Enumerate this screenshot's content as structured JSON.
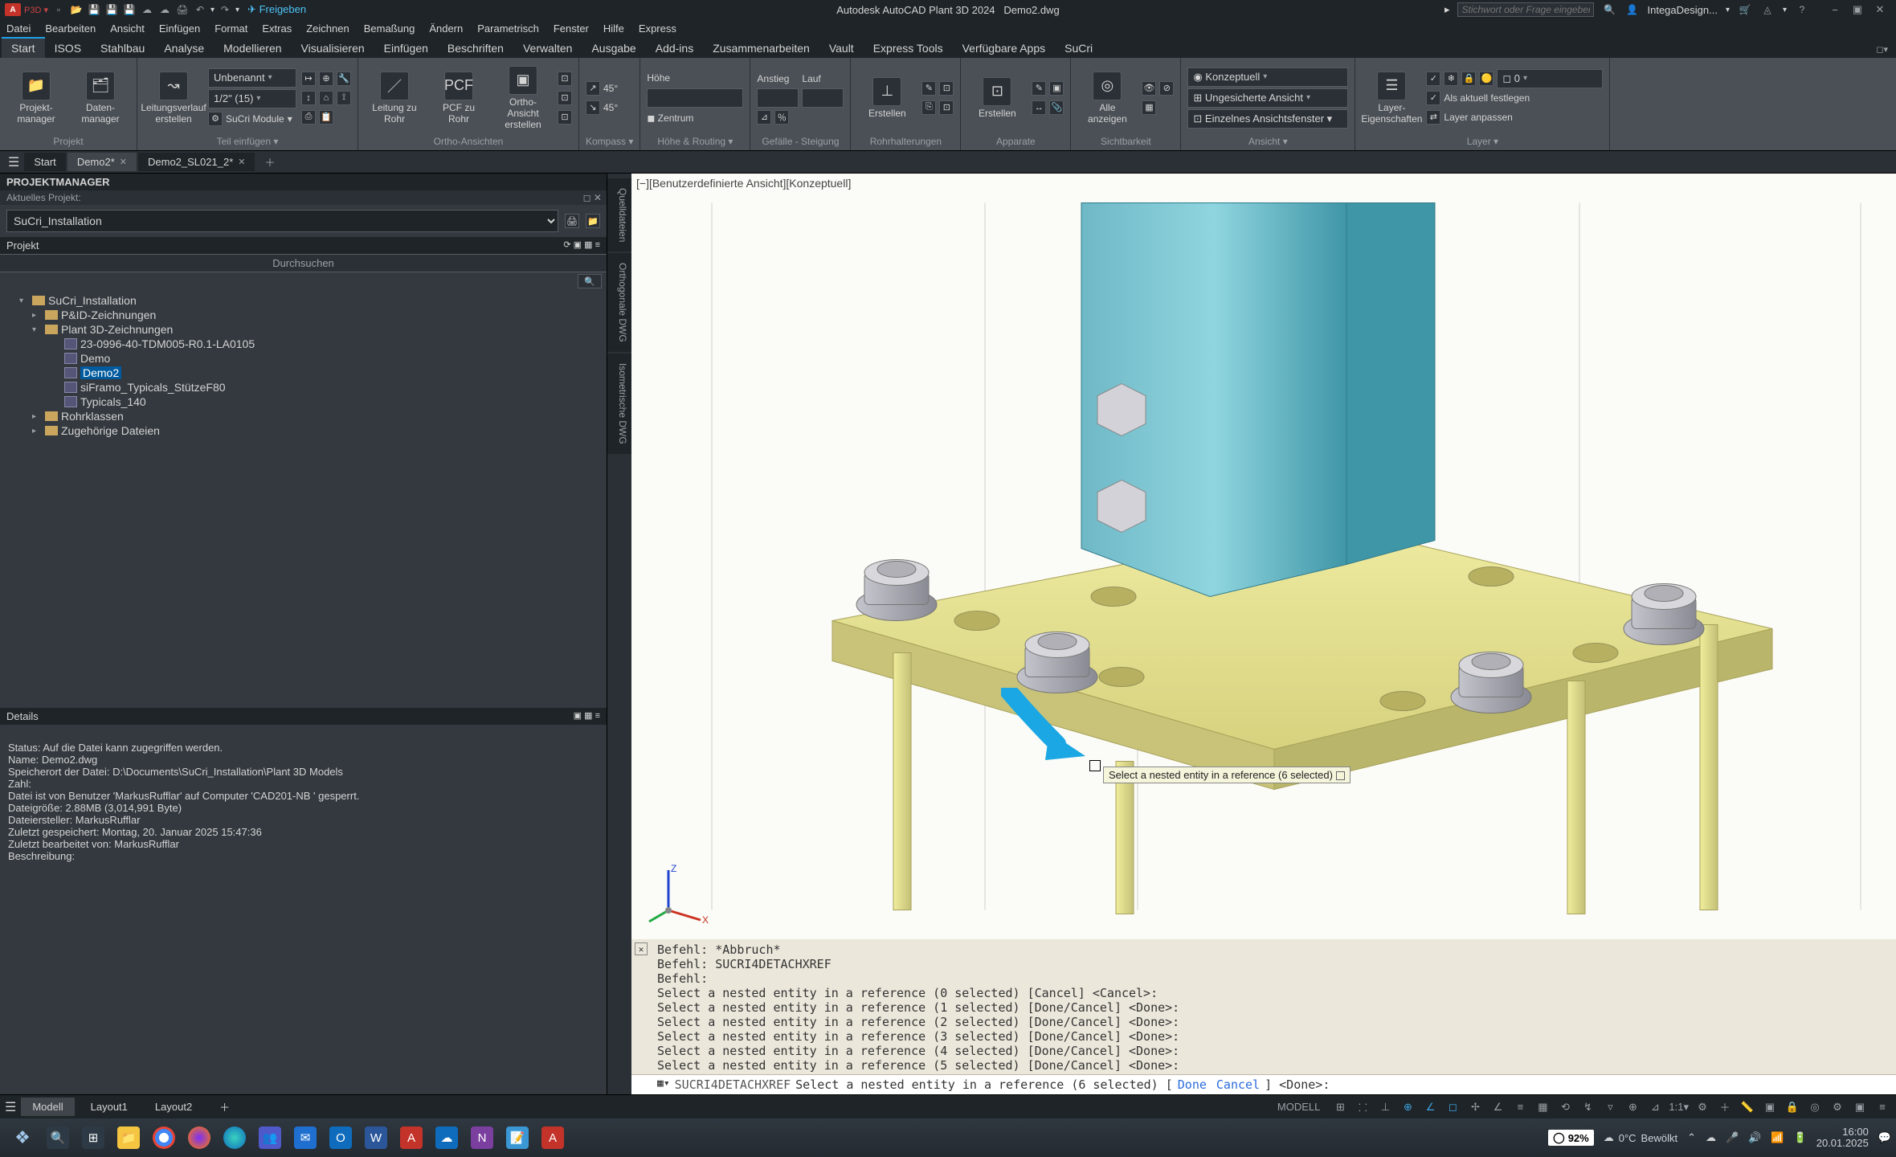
{
  "app": {
    "vendor": "Autodesk AutoCAD Plant 3D 2024",
    "doc": "Demo2.dwg",
    "share_btn": "Freigeben",
    "search_placeholder": "Stichwort oder Frage eingeben",
    "user": "IntegaDesign..."
  },
  "menus": [
    "Datei",
    "Bearbeiten",
    "Ansicht",
    "Einfügen",
    "Format",
    "Extras",
    "Zeichnen",
    "Bemaßung",
    "Ändern",
    "Parametrisch",
    "Fenster",
    "Hilfe",
    "Express"
  ],
  "ribbon_tabs": [
    "Start",
    "ISOS",
    "Stahlbau",
    "Analyse",
    "Modellieren",
    "Visualisieren",
    "Einfügen",
    "Beschriften",
    "Verwalten",
    "Ausgabe",
    "Add-ins",
    "Zusammenarbeiten",
    "Vault",
    "Express Tools",
    "Verfügbare Apps",
    "SuCri"
  ],
  "ribbon_active": "Start",
  "ribbon": {
    "grp_projekt": "Projekt",
    "projekt_manager": "Projekt-\nmanager",
    "daten_manager": "Daten-\nmanager",
    "leitung": "Leitungsverlauf\nerstellen",
    "dd_unbenannt": "Unbenannt",
    "dd_size": "1/2\" (15)",
    "sucri_module": "SuCri Module",
    "grp_teil": "Teil einfügen",
    "leitung_rohr": "Leitung zu\nRohr",
    "pcf_rohr": "PCF zu\nRohr",
    "ortho_erst": "Ortho-\nAnsicht\nerstellen",
    "deg45a": "45°",
    "deg45b": "45°",
    "grp_ortho": "Ortho-Ansichten",
    "grp_kompass": "Kompass ▾",
    "hoehe": "Höhe",
    "zentrum": "◼ Zentrum",
    "grp_hoehe": "Höhe & Routing ▾",
    "anstieg": "Anstieg",
    "lauf": "Lauf",
    "grp_gefaelle": "Gefälle - Steigung",
    "erstellen": "Erstellen",
    "erstellen2": "Erstellen",
    "grp_rohr": "Rohrhalterungen",
    "grp_apparate": "Apparate",
    "alle_anz": "Alle\nanzeigen",
    "grp_sichtbarkeit": "Sichtbarkeit",
    "konzeptuell": "◉ Konzeptuell",
    "unges": "⊞ Ungesicherte Ansicht",
    "einzel": "⊡ Einzelnes Ansichtsfenster ▾",
    "grp_ansicht": "Ansicht ▾",
    "layer_eig": "Layer-\nEigenschaften",
    "als_aktuell": "Als aktuell festlegen",
    "layer_anp": "Layer anpassen",
    "grp_layer": "Layer ▾",
    "layer_dd": "◻ 0"
  },
  "doc_tabs": [
    "Start",
    "Demo2*",
    "Demo2_SL021_2*"
  ],
  "doc_tab_active": 1,
  "vtabs": [
    "Quelldateien",
    "Orthogonale DWG",
    "Isometrische DWG"
  ],
  "pm": {
    "title": "PROJEKTMANAGER",
    "subtitle": "Aktuelles Projekt:",
    "project_sel": "SuCri_Installation",
    "hdr": "Projekt",
    "browse": "Durchsuchen"
  },
  "tree": {
    "root": "SuCri_Installation",
    "n1": "P&ID-Zeichnungen",
    "n2": "Plant 3D-Zeichnungen",
    "n2_1": "23-0996-40-TDM005-R0.1-LA0105",
    "n2_2": "Demo",
    "n2_3": "Demo2",
    "n2_4": "siFramo_Typicals_StützeF80",
    "n2_5": "Typicals_140",
    "n3": "Rohrklassen",
    "n4": "Zugehörige Dateien"
  },
  "details": {
    "hdr": "Details",
    "status": "Status: Auf die Datei kann zugegriffen werden.",
    "name": "Name: Demo2.dwg",
    "path": "Speicherort der Datei: D:\\Documents\\SuCri_Installation\\Plant 3D Models",
    "zahl": "Zahl:",
    "locked": "Datei ist von Benutzer 'MarkusRufflar' auf Computer 'CAD201-NB ' gesperrt.",
    "size": "Dateigröße: 2.88MB (3,014,991 Byte)",
    "creator": "Dateiersteller: MarkusRufflar",
    "saved": "Zuletzt gespeichert: Montag, 20. Januar 2025 15:47:36",
    "edited": "Zuletzt bearbeitet von: MarkusRufflar",
    "desc": "Beschreibung:"
  },
  "canvas": {
    "view_label": "[−][Benutzerdefinierte Ansicht][Konzeptuell]",
    "tooltip": "Select a nested entity in a reference (6 selected)"
  },
  "cmd": {
    "l1": "Befehl: *Abbruch*",
    "l2": "Befehl: SUCRI4DETACHXREF",
    "l3": "Befehl:",
    "l4": "Select a nested entity in a reference (0 selected) [Cancel] <Cancel>:",
    "l5": "Select a nested entity in a reference (1 selected) [Done/Cancel] <Done>:",
    "l6": "Select a nested entity in a reference (2 selected) [Done/Cancel] <Done>:",
    "l7": "Select a nested entity in a reference (3 selected) [Done/Cancel] <Done>:",
    "l8": "Select a nested entity in a reference (4 selected) [Done/Cancel] <Done>:",
    "l9": "Select a nested entity in a reference (5 selected) [Done/Cancel] <Done>:",
    "current_cmd": "SUCRI4DETACHXREF",
    "prompt": "Select a nested entity in a reference (6 selected) [",
    "opt1": "Done",
    "opt_sep": " ",
    "opt2": "Cancel",
    "prompt_end": "] <Done>:"
  },
  "modeltabs": [
    "Modell",
    "Layout1",
    "Layout2"
  ],
  "modeltabs_active": 0,
  "status_model": "MODELL",
  "status_ratio": "1:1",
  "taskbar": {
    "weather_temp": "0°C",
    "weather_txt": "Bewölkt",
    "pct": "92%",
    "time": "16:00",
    "date": "20.01.2025"
  }
}
